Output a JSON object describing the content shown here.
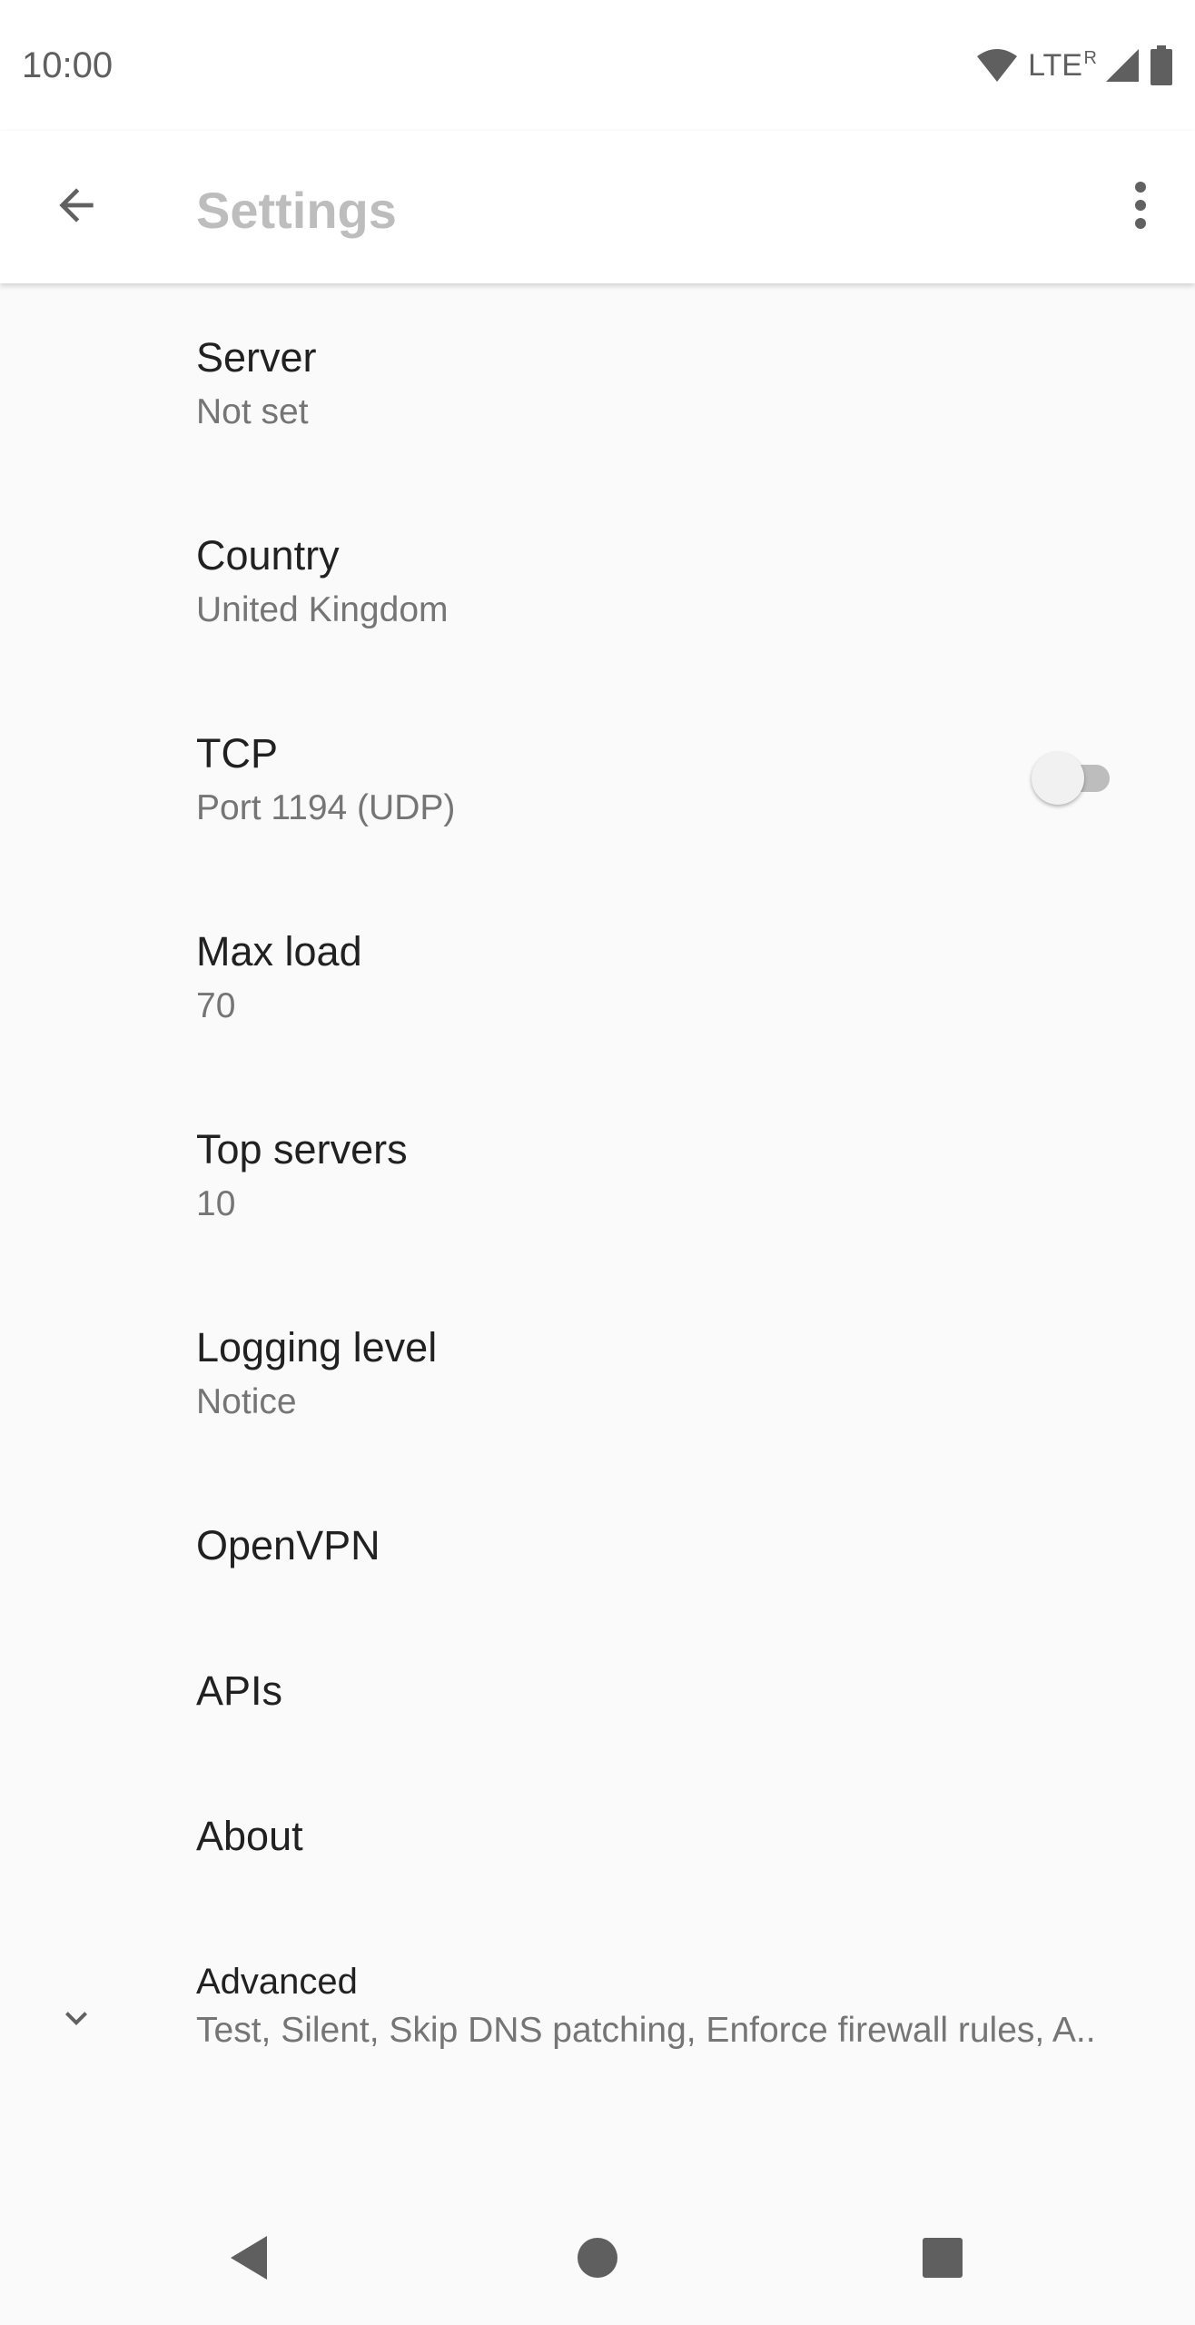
{
  "status_bar": {
    "time": "10:00",
    "network_label": "LTE",
    "roaming_label": "R",
    "icons": [
      "wifi-icon",
      "signal-icon",
      "battery-icon"
    ]
  },
  "app_bar": {
    "title": "Settings",
    "back_icon": "arrow-back-icon",
    "overflow_icon": "more-vert-icon"
  },
  "preferences": {
    "server": {
      "title": "Server",
      "summary": "Not set"
    },
    "country": {
      "title": "Country",
      "summary": "United Kingdom"
    },
    "tcp": {
      "title": "TCP",
      "summary": "Port 1194 (UDP)",
      "enabled": false
    },
    "max_load": {
      "title": "Max load",
      "summary": "70"
    },
    "top_servers": {
      "title": "Top servers",
      "summary": "10"
    },
    "logging_level": {
      "title": "Logging level",
      "summary": "Notice"
    },
    "openvpn": {
      "title": "OpenVPN"
    },
    "apis": {
      "title": "APIs"
    },
    "about": {
      "title": "About"
    },
    "advanced": {
      "title": "Advanced",
      "summary": "Test, Silent, Skip DNS patching, Enforce firewall rules, A..",
      "icon": "chevron-down-icon"
    }
  },
  "nav_bar": {
    "icons": [
      "back-triangle-icon",
      "home-circle-icon",
      "recents-square-icon"
    ]
  },
  "colors": {
    "background": "#fafafa",
    "title_text": "#212121",
    "summary_text": "#757575",
    "app_title": "#bdbdbd",
    "icon": "#5f5f5f"
  }
}
